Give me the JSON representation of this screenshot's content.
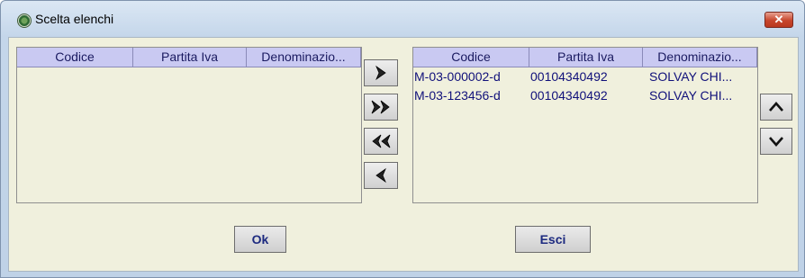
{
  "window": {
    "title": "Scelta elenchi",
    "close_glyph": "✕",
    "icon": "app-emblem-icon"
  },
  "left_table": {
    "columns": [
      "Codice",
      "Partita Iva",
      "Denominazio..."
    ],
    "rows": []
  },
  "right_table": {
    "columns": [
      "Codice",
      "Partita Iva",
      "Denominazio..."
    ],
    "rows": [
      [
        "M-03-000002-d",
        "00104340492",
        "SOLVAY CHI..."
      ],
      [
        "M-03-123456-d",
        "00104340492",
        "SOLVAY CHI..."
      ]
    ]
  },
  "transfer_buttons": [
    "move-selected-right-icon",
    "move-all-right-icon",
    "move-all-left-icon",
    "move-selected-left-icon"
  ],
  "order_buttons": [
    "move-up-icon",
    "move-down-icon"
  ],
  "footer": {
    "ok_label": "Ok",
    "exit_label": "Esci"
  },
  "colors": {
    "header_bg": "#c9c9f2",
    "header_text": "#1a1a60",
    "row_text": "#10107a",
    "client_bg": "#f0f0dd",
    "close_button": "#c7462c"
  }
}
